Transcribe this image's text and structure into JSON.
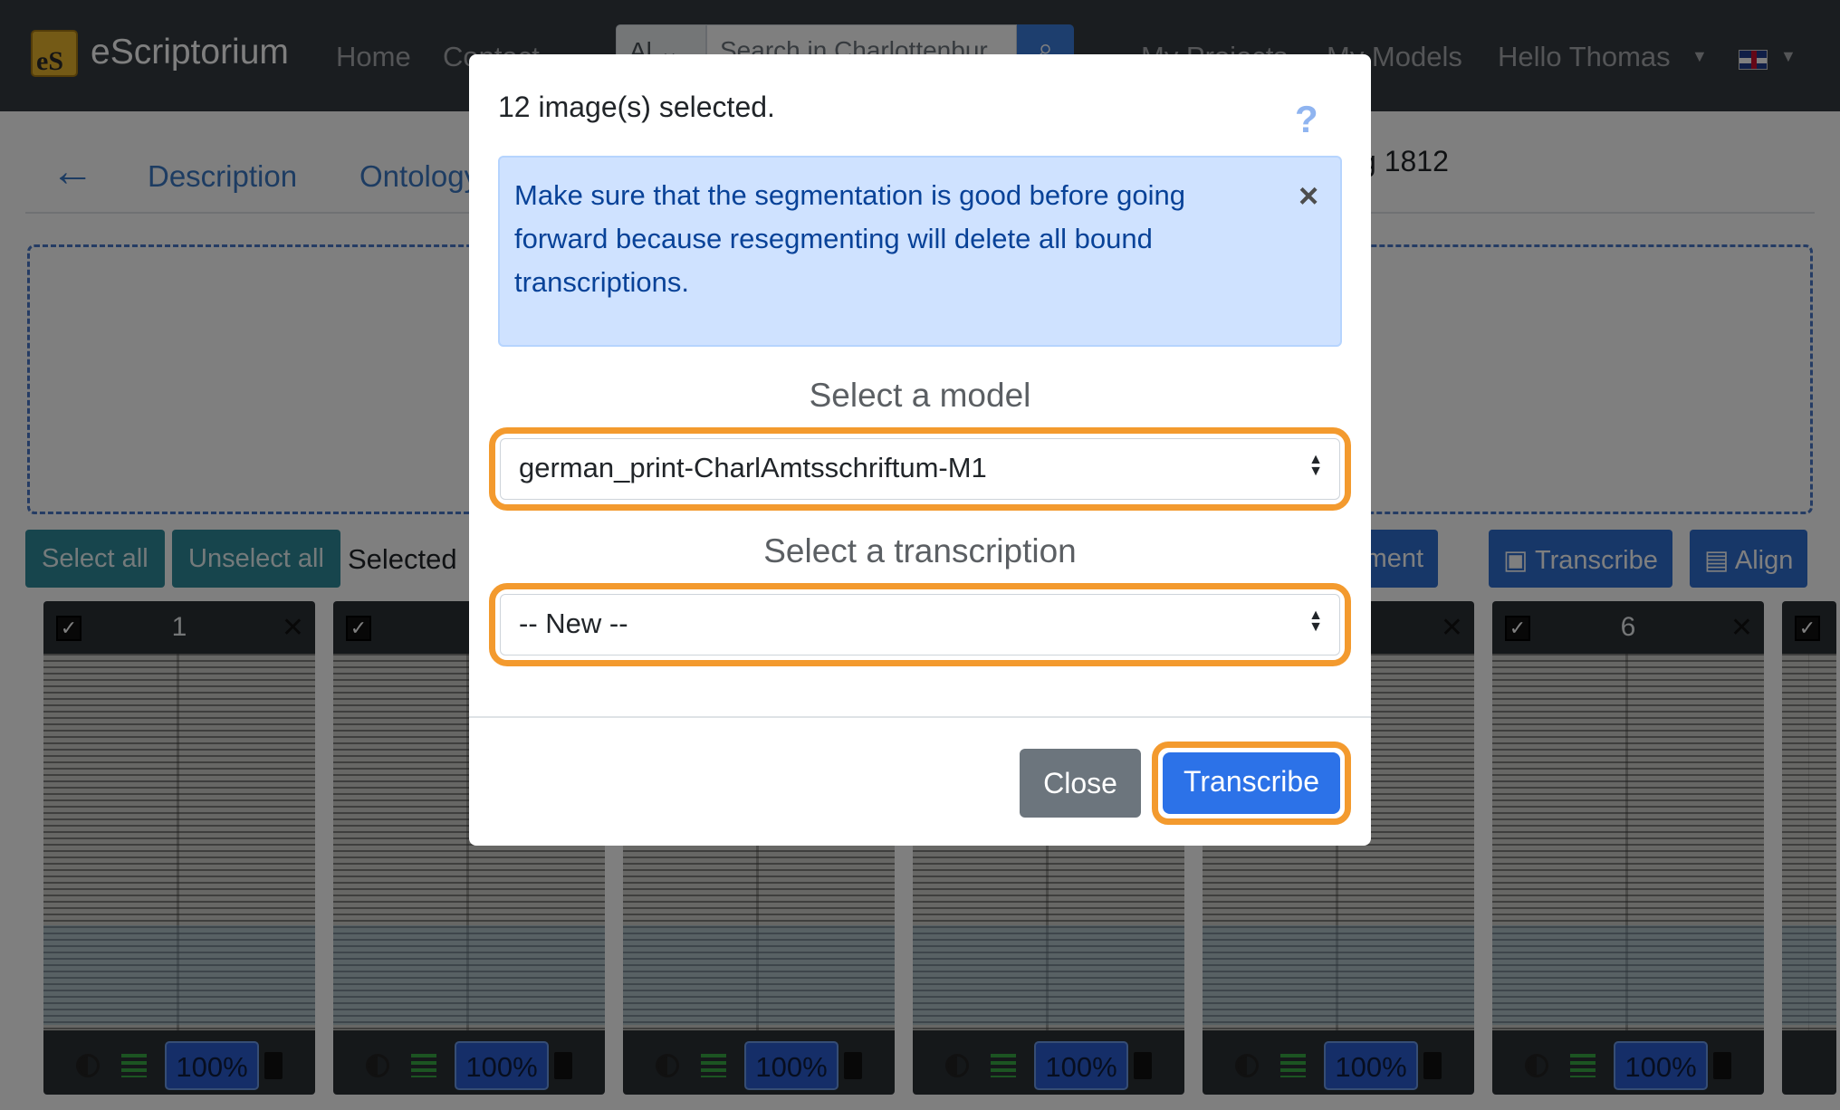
{
  "navbar": {
    "brand_logo_text": "eS",
    "brand_name": "eScriptorium",
    "links": [
      "Home",
      "Contact"
    ],
    "search_scope": "Al",
    "search_placeholder": "Search in Charlottenbur",
    "right_links": [
      "My Projects",
      "My Models"
    ],
    "user_menu": "Hello Thomas"
  },
  "document": {
    "tabs": [
      "Description",
      "Ontology"
    ],
    "title_fragment": "g 1812"
  },
  "toolbar": {
    "select_all": "Select all",
    "unselect_all": "Unselect all",
    "selected_label": "Selected",
    "segment": "Segment",
    "transcribe": "Transcribe",
    "align": "Align"
  },
  "cards": [
    {
      "number": "1",
      "zoom": "100%"
    },
    {
      "number": "",
      "zoom": "100%"
    },
    {
      "number": "",
      "zoom": "100%"
    },
    {
      "number": "",
      "zoom": "100%"
    },
    {
      "number": "",
      "zoom": "100%"
    },
    {
      "number": "6",
      "zoom": "100%"
    }
  ],
  "modal": {
    "title": "12 image(s) selected.",
    "help": "?",
    "alert": "Make sure that the segmentation is good before going forward because resegmenting will delete all bound transcriptions.",
    "alert_close": "×",
    "model_label": "Select a model",
    "model_value": "german_print-CharlAmtsschriftum-M1",
    "transcription_label": "Select a transcription",
    "transcription_value": "-- New --",
    "close_button": "Close",
    "transcribe_button": "Transcribe"
  },
  "colors": {
    "navbar": "#343a40",
    "highlight": "#f39a2e",
    "primary": "#2c72e8",
    "alert_bg": "#cfe2ff",
    "teal": "#2e8b9a"
  }
}
